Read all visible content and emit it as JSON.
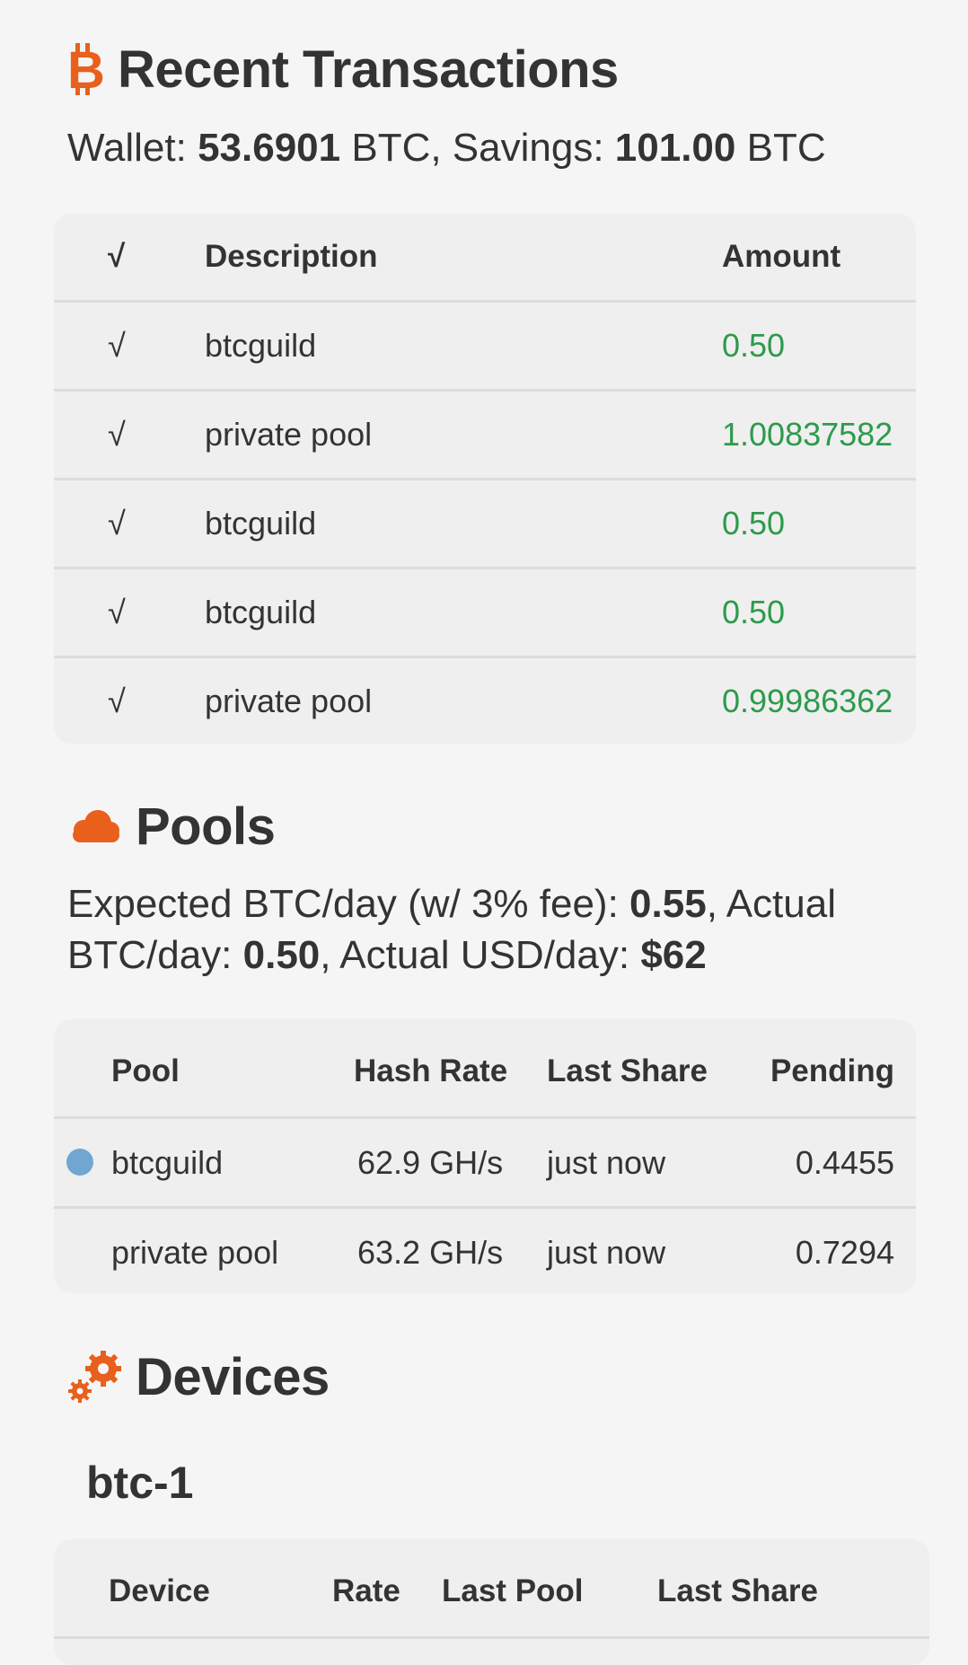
{
  "transactions": {
    "title": "Recent Transactions",
    "icon": "bitcoin-icon",
    "summary": {
      "wallet_label": "Wallet: ",
      "wallet_value": "53.6901",
      "wallet_unit": " BTC, Savings: ",
      "savings_value": "101.00",
      "savings_unit": " BTC"
    },
    "headers": {
      "check": "√",
      "description": "Description",
      "amount": "Amount"
    },
    "rows": [
      {
        "check": "√",
        "description": "btcguild",
        "amount": "0.50"
      },
      {
        "check": "√",
        "description": "private pool",
        "amount": "1.00837582"
      },
      {
        "check": "√",
        "description": "btcguild",
        "amount": "0.50"
      },
      {
        "check": "√",
        "description": "btcguild",
        "amount": "0.50"
      },
      {
        "check": "√",
        "description": "private pool",
        "amount": "0.99986362"
      }
    ]
  },
  "pools": {
    "title": "Pools",
    "icon": "cloud-icon",
    "summary": {
      "expected_label": "Expected BTC/day (w/ 3% fee): ",
      "expected_value": "0.55",
      "actual_btc_label": ", Actual BTC/day: ",
      "actual_btc_value": "0.50",
      "actual_usd_label": ", Actual USD/day: ",
      "actual_usd_value": "$62"
    },
    "headers": {
      "pool": "Pool",
      "hash_rate": "Hash Rate",
      "last_share": "Last Share",
      "pending": "Pending"
    },
    "rows": [
      {
        "active": true,
        "pool": "btcguild",
        "hash_rate": "62.9 GH/s",
        "last_share": "just now",
        "pending": "0.4455"
      },
      {
        "active": false,
        "pool": "private pool",
        "hash_rate": "63.2 GH/s",
        "last_share": "just now",
        "pending": "0.7294"
      }
    ],
    "active_dot_color": "#72a6d2"
  },
  "devices": {
    "title": "Devices",
    "icon": "gears-icon",
    "groups": [
      {
        "name": "btc-1",
        "headers": {
          "device": "Device",
          "rate": "Rate",
          "last_pool": "Last Pool",
          "last_share": "Last Share"
        }
      }
    ]
  },
  "colors": {
    "accent": "#e8601c",
    "positive": "#2e9a4c",
    "text": "#333333",
    "background": "#f5f5f5",
    "panel": "#efefef"
  }
}
